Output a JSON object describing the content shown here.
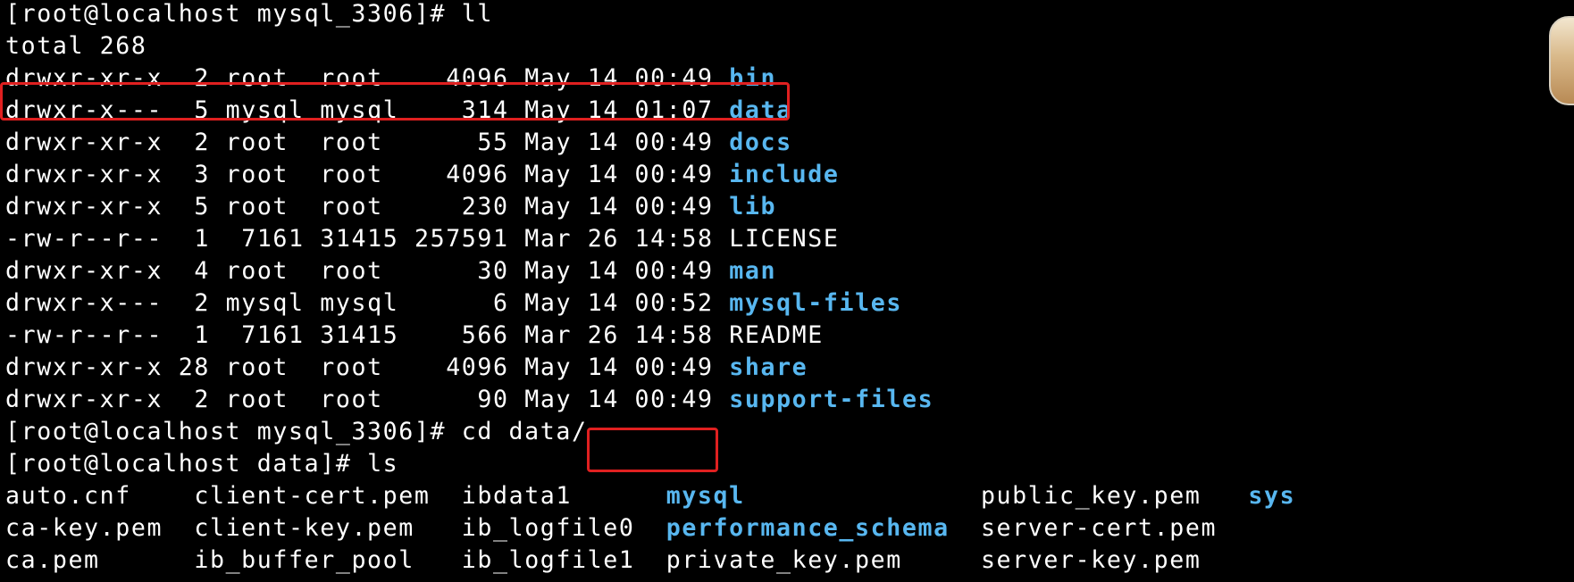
{
  "terminal": {
    "prompt_1": "[root@localhost mysql_3306]# ",
    "command_1": "ll",
    "total_line": "total 268",
    "listing": [
      {
        "perm": "drwxr-xr-x",
        "links": " 2",
        "owner": "root ",
        "group": "root ",
        "size": "  4096",
        "date": "May 14 00:49",
        "name": "bin",
        "is_dir": true
      },
      {
        "perm": "drwxr-x---",
        "links": " 5",
        "owner": "mysql",
        "group": "mysql",
        "size": "   314",
        "date": "May 14 01:07",
        "name": "data",
        "is_dir": true
      },
      {
        "perm": "drwxr-xr-x",
        "links": " 2",
        "owner": "root ",
        "group": "root ",
        "size": "    55",
        "date": "May 14 00:49",
        "name": "docs",
        "is_dir": true
      },
      {
        "perm": "drwxr-xr-x",
        "links": " 3",
        "owner": "root ",
        "group": "root ",
        "size": "  4096",
        "date": "May 14 00:49",
        "name": "include",
        "is_dir": true
      },
      {
        "perm": "drwxr-xr-x",
        "links": " 5",
        "owner": "root ",
        "group": "root ",
        "size": "   230",
        "date": "May 14 00:49",
        "name": "lib",
        "is_dir": true
      },
      {
        "perm": "-rw-r--r--",
        "links": " 1",
        "owner": " 7161",
        "group": "31415",
        "size": "257591",
        "date": "Mar 26 14:58",
        "name": "LICENSE",
        "is_dir": false
      },
      {
        "perm": "drwxr-xr-x",
        "links": " 4",
        "owner": "root ",
        "group": "root ",
        "size": "    30",
        "date": "May 14 00:49",
        "name": "man",
        "is_dir": true
      },
      {
        "perm": "drwxr-x---",
        "links": " 2",
        "owner": "mysql",
        "group": "mysql",
        "size": "     6",
        "date": "May 14 00:52",
        "name": "mysql-files",
        "is_dir": true
      },
      {
        "perm": "-rw-r--r--",
        "links": " 1",
        "owner": " 7161",
        "group": "31415",
        "size": "   566",
        "date": "Mar 26 14:58",
        "name": "README",
        "is_dir": false
      },
      {
        "perm": "drwxr-xr-x",
        "links": "28",
        "owner": "root ",
        "group": "root ",
        "size": "  4096",
        "date": "May 14 00:49",
        "name": "share",
        "is_dir": true
      },
      {
        "perm": "drwxr-xr-x",
        "links": " 2",
        "owner": "root ",
        "group": "root ",
        "size": "    90",
        "date": "May 14 00:49",
        "name": "support-files",
        "is_dir": true
      }
    ],
    "prompt_2": "[root@localhost mysql_3306]# ",
    "command_2": "cd data/",
    "prompt_3": "[root@localhost data]# ",
    "command_3": "ls",
    "ls_rows": [
      [
        {
          "name": "auto.cnf",
          "is_dir": false,
          "pad": "    "
        },
        {
          "name": "client-cert.pem",
          "is_dir": false,
          "pad": "  "
        },
        {
          "name": "ibdata1",
          "is_dir": false,
          "pad": "      "
        },
        {
          "name": "mysql",
          "is_dir": true,
          "pad": "               "
        },
        {
          "name": "public_key.pem",
          "is_dir": false,
          "pad": "   "
        },
        {
          "name": "sys",
          "is_dir": true,
          "pad": ""
        }
      ],
      [
        {
          "name": "ca-key.pem",
          "is_dir": false,
          "pad": "  "
        },
        {
          "name": "client-key.pem",
          "is_dir": false,
          "pad": "   "
        },
        {
          "name": "ib_logfile0",
          "is_dir": false,
          "pad": "  "
        },
        {
          "name": "performance_schema",
          "is_dir": true,
          "pad": "  "
        },
        {
          "name": "server-cert.pem",
          "is_dir": false,
          "pad": ""
        }
      ],
      [
        {
          "name": "ca.pem",
          "is_dir": false,
          "pad": "      "
        },
        {
          "name": "ib_buffer_pool",
          "is_dir": false,
          "pad": "   "
        },
        {
          "name": "ib_logfile1",
          "is_dir": false,
          "pad": "  "
        },
        {
          "name": "private_key.pem",
          "is_dir": false,
          "pad": "     "
        },
        {
          "name": "server-key.pem",
          "is_dir": false,
          "pad": ""
        }
      ]
    ]
  },
  "colors": {
    "background": "#000000",
    "text": "#ffffff",
    "directory": "#58b7f0",
    "highlight_box": "#e02020"
  }
}
